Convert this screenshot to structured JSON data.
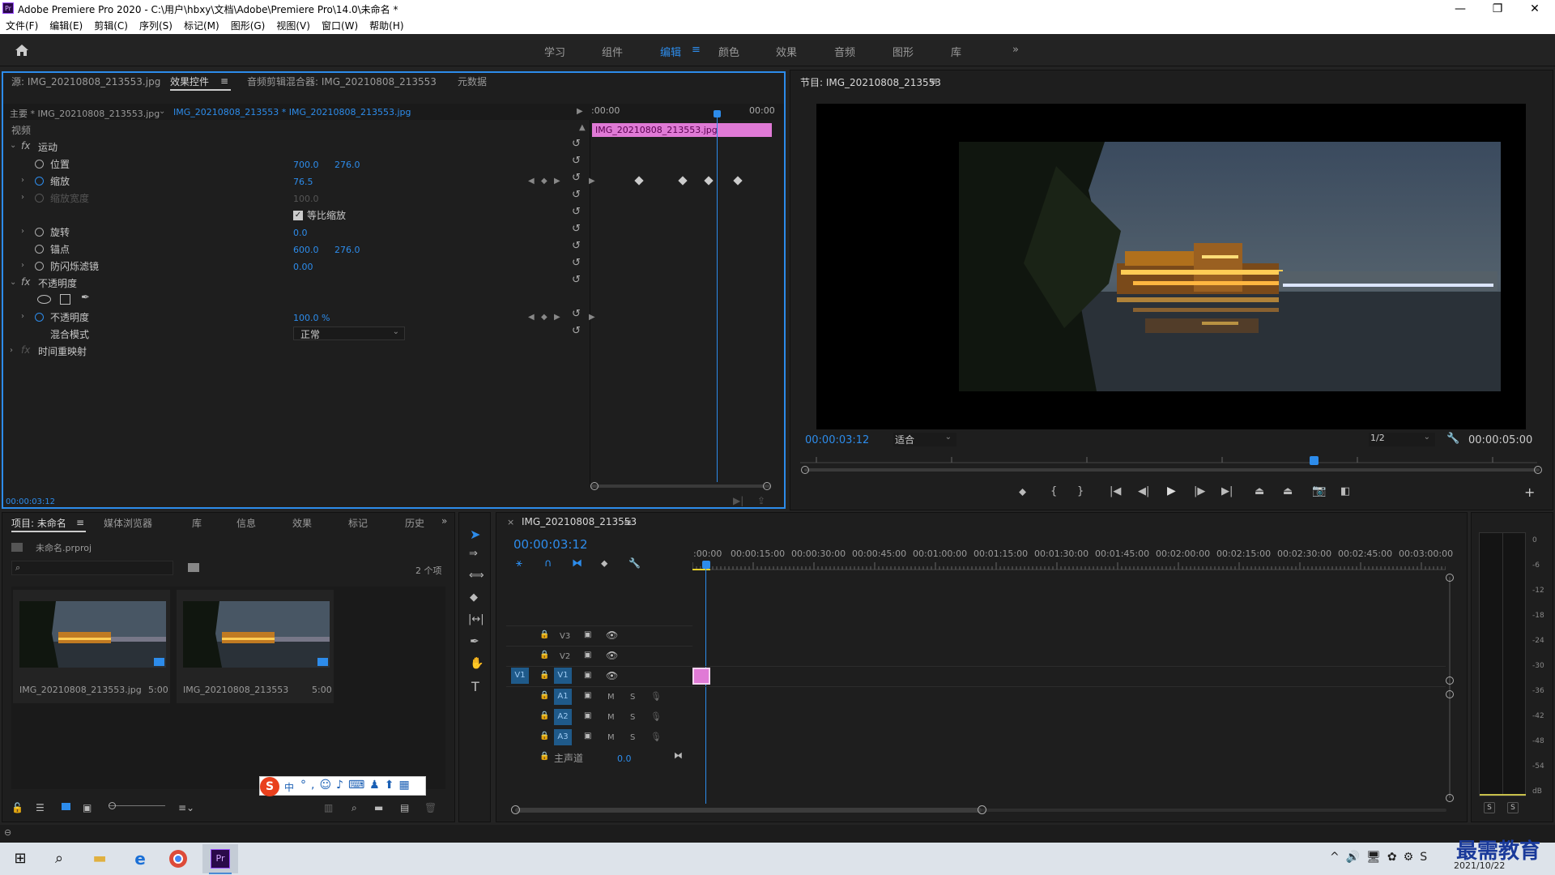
{
  "window": {
    "title": "Adobe Premiere Pro 2020 - C:\\用户\\hbxy\\文档\\Adobe\\Premiere Pro\\14.0\\未命名 *",
    "badge": "Pr"
  },
  "menu": [
    "文件(F)",
    "编辑(E)",
    "剪辑(C)",
    "序列(S)",
    "标记(M)",
    "图形(G)",
    "视图(V)",
    "窗口(W)",
    "帮助(H)"
  ],
  "workspaces": [
    "学习",
    "组件",
    "编辑",
    "颜色",
    "效果",
    "音频",
    "图形",
    "库"
  ],
  "workspace_active": "编辑",
  "source_panel": {
    "tabs": [
      "源: IMG_20210808_213553.jpg",
      "效果控件",
      "音频剪辑混合器: IMG_20210808_213553",
      "元数据"
    ],
    "master_clip": "主要 * IMG_20210808_213553.jpg",
    "seq_clip": "IMG_20210808_213553 * IMG_20210808_213553.jpg",
    "time_start": ":00:00",
    "time_end": "00:00",
    "clip_label": "IMG_20210808_213553.jpg",
    "section_video": "视频",
    "motion": "运动",
    "position": {
      "label": "位置",
      "x": "700.0",
      "y": "276.0"
    },
    "scale": {
      "label": "缩放",
      "value": "76.5"
    },
    "scale_width": {
      "label": "缩放宽度",
      "value": "100.0"
    },
    "uniform_scale": "等比缩放",
    "rotation": {
      "label": "旋转",
      "value": "0.0"
    },
    "anchor": {
      "label": "锚点",
      "x": "600.0",
      "y": "276.0"
    },
    "antiflicker": {
      "label": "防闪烁滤镜",
      "value": "0.00"
    },
    "opacity_group": "不透明度",
    "opacity": {
      "label": "不透明度",
      "value": "100.0 %"
    },
    "blend_mode": {
      "label": "混合模式",
      "value": "正常"
    },
    "time_remap": "时间重映射",
    "timecode": "00:00:03:12",
    "fx": "fx"
  },
  "program_panel": {
    "title": "节目: IMG_20210808_213553",
    "timecode": "00:00:03:12",
    "fit": "适合",
    "quality": "1/2",
    "duration": "00:00:05:00"
  },
  "project_panel": {
    "tabs": [
      "项目: 未命名",
      "媒体浏览器",
      "库",
      "信息",
      "效果",
      "标记",
      "历史"
    ],
    "file": "未命名.prproj",
    "item_count": "2 个项",
    "items": [
      {
        "name": "IMG_20210808_213553.jpg",
        "duration": "5:00"
      },
      {
        "name": "IMG_20210808_213553",
        "duration": "5:00"
      }
    ]
  },
  "timeline": {
    "tab": "IMG_20210808_213553",
    "timecode": "00:00:03:12",
    "ruler": [
      ":00:00",
      "00:00:15:00",
      "00:00:30:00",
      "00:00:45:00",
      "00:01:00:00",
      "00:01:15:00",
      "00:01:30:00",
      "00:01:45:00",
      "00:02:00:00",
      "00:02:15:00",
      "00:02:30:00",
      "00:02:45:00",
      "00:03:00:00"
    ],
    "video_tracks": [
      "V3",
      "V2",
      "V1"
    ],
    "audio_tracks": [
      "A1",
      "A2",
      "A3"
    ],
    "source_v": "V1",
    "mute": "M",
    "solo": "S",
    "master": {
      "label": "主声道",
      "value": "0.0"
    }
  },
  "meter": {
    "scale": [
      "0",
      "-6",
      "-12",
      "-18",
      "-24",
      "-30",
      "-36",
      "-42",
      "-48",
      "-54",
      "dB"
    ],
    "solo": [
      "S",
      "S"
    ]
  },
  "ime": {
    "text": "中"
  },
  "taskbar": {
    "date": "2021/10/22"
  },
  "watermark": "最需教育",
  "colors": {
    "accent": "#2d8ceb",
    "clip": "#e07ad6"
  }
}
